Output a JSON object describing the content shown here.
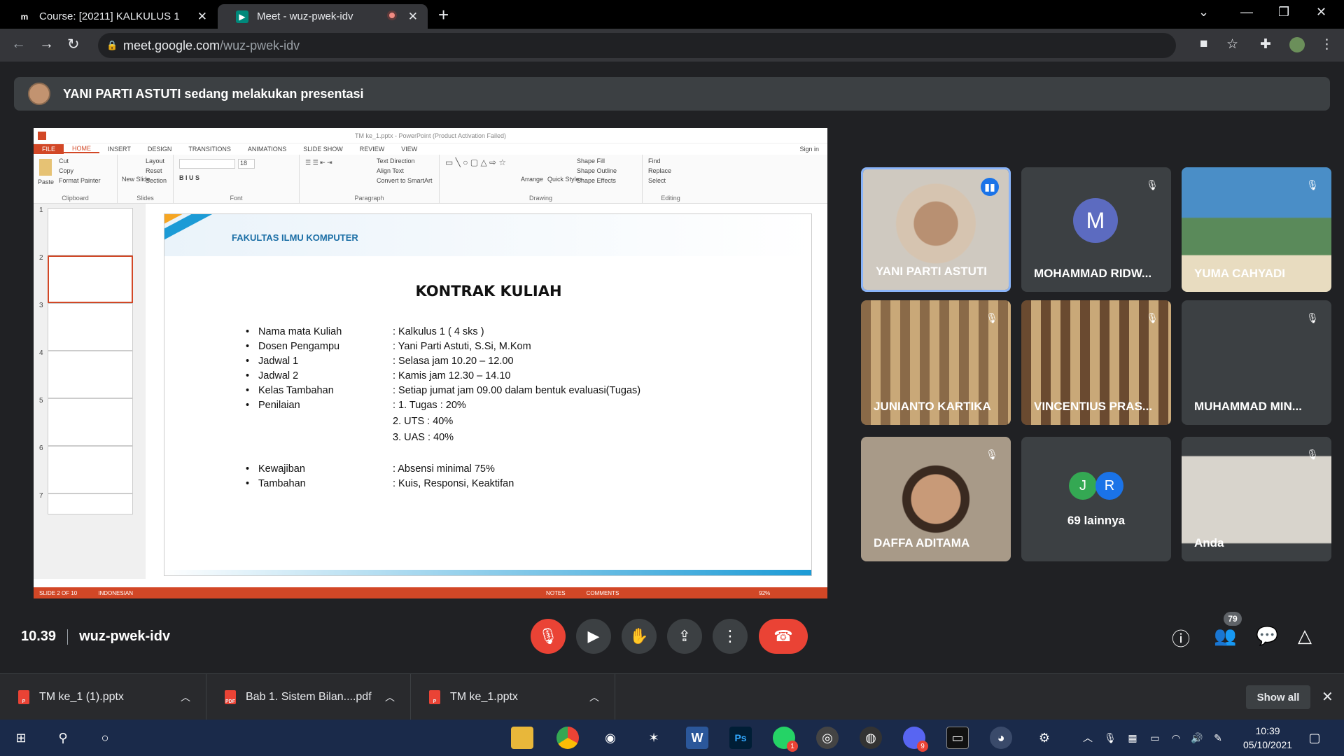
{
  "browser": {
    "tabs": [
      {
        "title": "Course: [20211] KALKULUS 1",
        "favicon": "m"
      },
      {
        "title": "Meet - wuz-pwek-idv",
        "favicon": "meet"
      }
    ],
    "url_host": "meet.google.com",
    "url_path": "/wuz-pwek-idv"
  },
  "banner": {
    "text": "YANI PARTI ASTUTI sedang melakukan presentasi"
  },
  "ppt": {
    "window_title": "TM ke_1.pptx - PowerPoint (Product Activation Failed)",
    "sign_in": "Sign in",
    "ribbon_tabs": [
      "FILE",
      "HOME",
      "INSERT",
      "DESIGN",
      "TRANSITIONS",
      "ANIMATIONS",
      "SLIDE SHOW",
      "REVIEW",
      "VIEW"
    ],
    "ribbon_groups": {
      "clipboard": {
        "label": "Clipboard",
        "paste": "Paste",
        "cut": "Cut",
        "copy": "Copy",
        "format_painter": "Format Painter"
      },
      "slides": {
        "label": "Slides",
        "new_slide": "New Slide",
        "layout": "Layout",
        "reset": "Reset",
        "section": "Section"
      },
      "font": {
        "label": "Font",
        "size": "18"
      },
      "paragraph": {
        "label": "Paragraph",
        "text_direction": "Text Direction",
        "align_text": "Align Text",
        "smartart": "Convert to SmartArt"
      },
      "drawing": {
        "label": "Drawing",
        "arrange": "Arrange",
        "quick_styles": "Quick Styles",
        "shape_fill": "Shape Fill",
        "shape_outline": "Shape Outline",
        "shape_effects": "Shape Effects"
      },
      "editing": {
        "label": "Editing",
        "find": "Find",
        "replace": "Replace",
        "select": "Select"
      }
    },
    "thumbnails": [
      "1",
      "2",
      "3",
      "4",
      "5",
      "6",
      "7"
    ],
    "slide": {
      "header": "FAKULTAS ILMU KOMPUTER",
      "title": "KONTRAK KULIAH",
      "rows": [
        {
          "key": "Nama mata Kuliah",
          "val": ": Kalkulus 1 ( 4 sks )",
          "bullet": true
        },
        {
          "key": "Dosen Pengampu",
          "val": ": Yani Parti Astuti, S.Si, M.Kom",
          "bullet": true
        },
        {
          "key": "Jadwal 1",
          "val": ": Selasa jam 10.20 – 12.00",
          "bullet": true
        },
        {
          "key": "Jadwal 2",
          "val": ": Kamis jam 12.30 – 14.10",
          "bullet": true
        },
        {
          "key": "Kelas Tambahan",
          "val": ": Setiap jumat jam 09.00 dalam bentuk evaluasi(Tugas)",
          "bullet": true
        },
        {
          "key": "Penilaian",
          "val": ": 1. Tugas  : 20%",
          "bullet": true
        },
        {
          "key": "",
          "val": "  2. UTS    : 40%",
          "bullet": false
        },
        {
          "key": "",
          "val": "  3. UAS    : 40%",
          "bullet": false
        },
        {
          "key": "Kewajiban",
          "val": ": Absensi minimal 75%",
          "bullet": true
        },
        {
          "key": "Tambahan",
          "val": ": Kuis, Responsi, Keaktifan",
          "bullet": true
        }
      ]
    },
    "status": {
      "slide": "SLIDE 2 OF 10",
      "language": "INDONESIAN",
      "notes": "NOTES",
      "comments": "COMMENTS",
      "zoom": "92%"
    }
  },
  "participants": [
    {
      "name": "YANI PARTI ASTUTI",
      "state": "speaking"
    },
    {
      "name": "MOHAMMAD RIDW...",
      "state": "muted",
      "initial": "M"
    },
    {
      "name": "YUMA CAHYADI",
      "state": "muted"
    },
    {
      "name": "JUNIANTO KARTIKA",
      "state": "muted"
    },
    {
      "name": "VINCENTIUS PRAS...",
      "state": "muted"
    },
    {
      "name": "MUHAMMAD MIN...",
      "state": "muted"
    },
    {
      "name": "DAFFA ADITAMA",
      "state": "muted"
    },
    {
      "name": "69 lainnya",
      "initials": [
        "J",
        "R"
      ]
    },
    {
      "name": "Anda",
      "state": "muted"
    }
  ],
  "meeting": {
    "time": "10.39",
    "code": "wuz-pwek-idv",
    "participant_count": "79"
  },
  "colors": {
    "accent_red": "#ea4335",
    "meet_bg": "#202124",
    "tile_bg": "#3c4043",
    "ppt_orange": "#d24726"
  },
  "downloads": {
    "items": [
      {
        "name": "TM ke_1 (1).pptx",
        "type": "pptx"
      },
      {
        "name": "Bab 1. Sistem Bilan....pdf",
        "type": "pdf"
      },
      {
        "name": "TM ke_1.pptx",
        "type": "pptx"
      }
    ],
    "show_all": "Show all"
  },
  "taskbar": {
    "time": "10:39",
    "date": "05/10/2021",
    "whatsapp_badge": "1",
    "chrome_badge": "9"
  }
}
